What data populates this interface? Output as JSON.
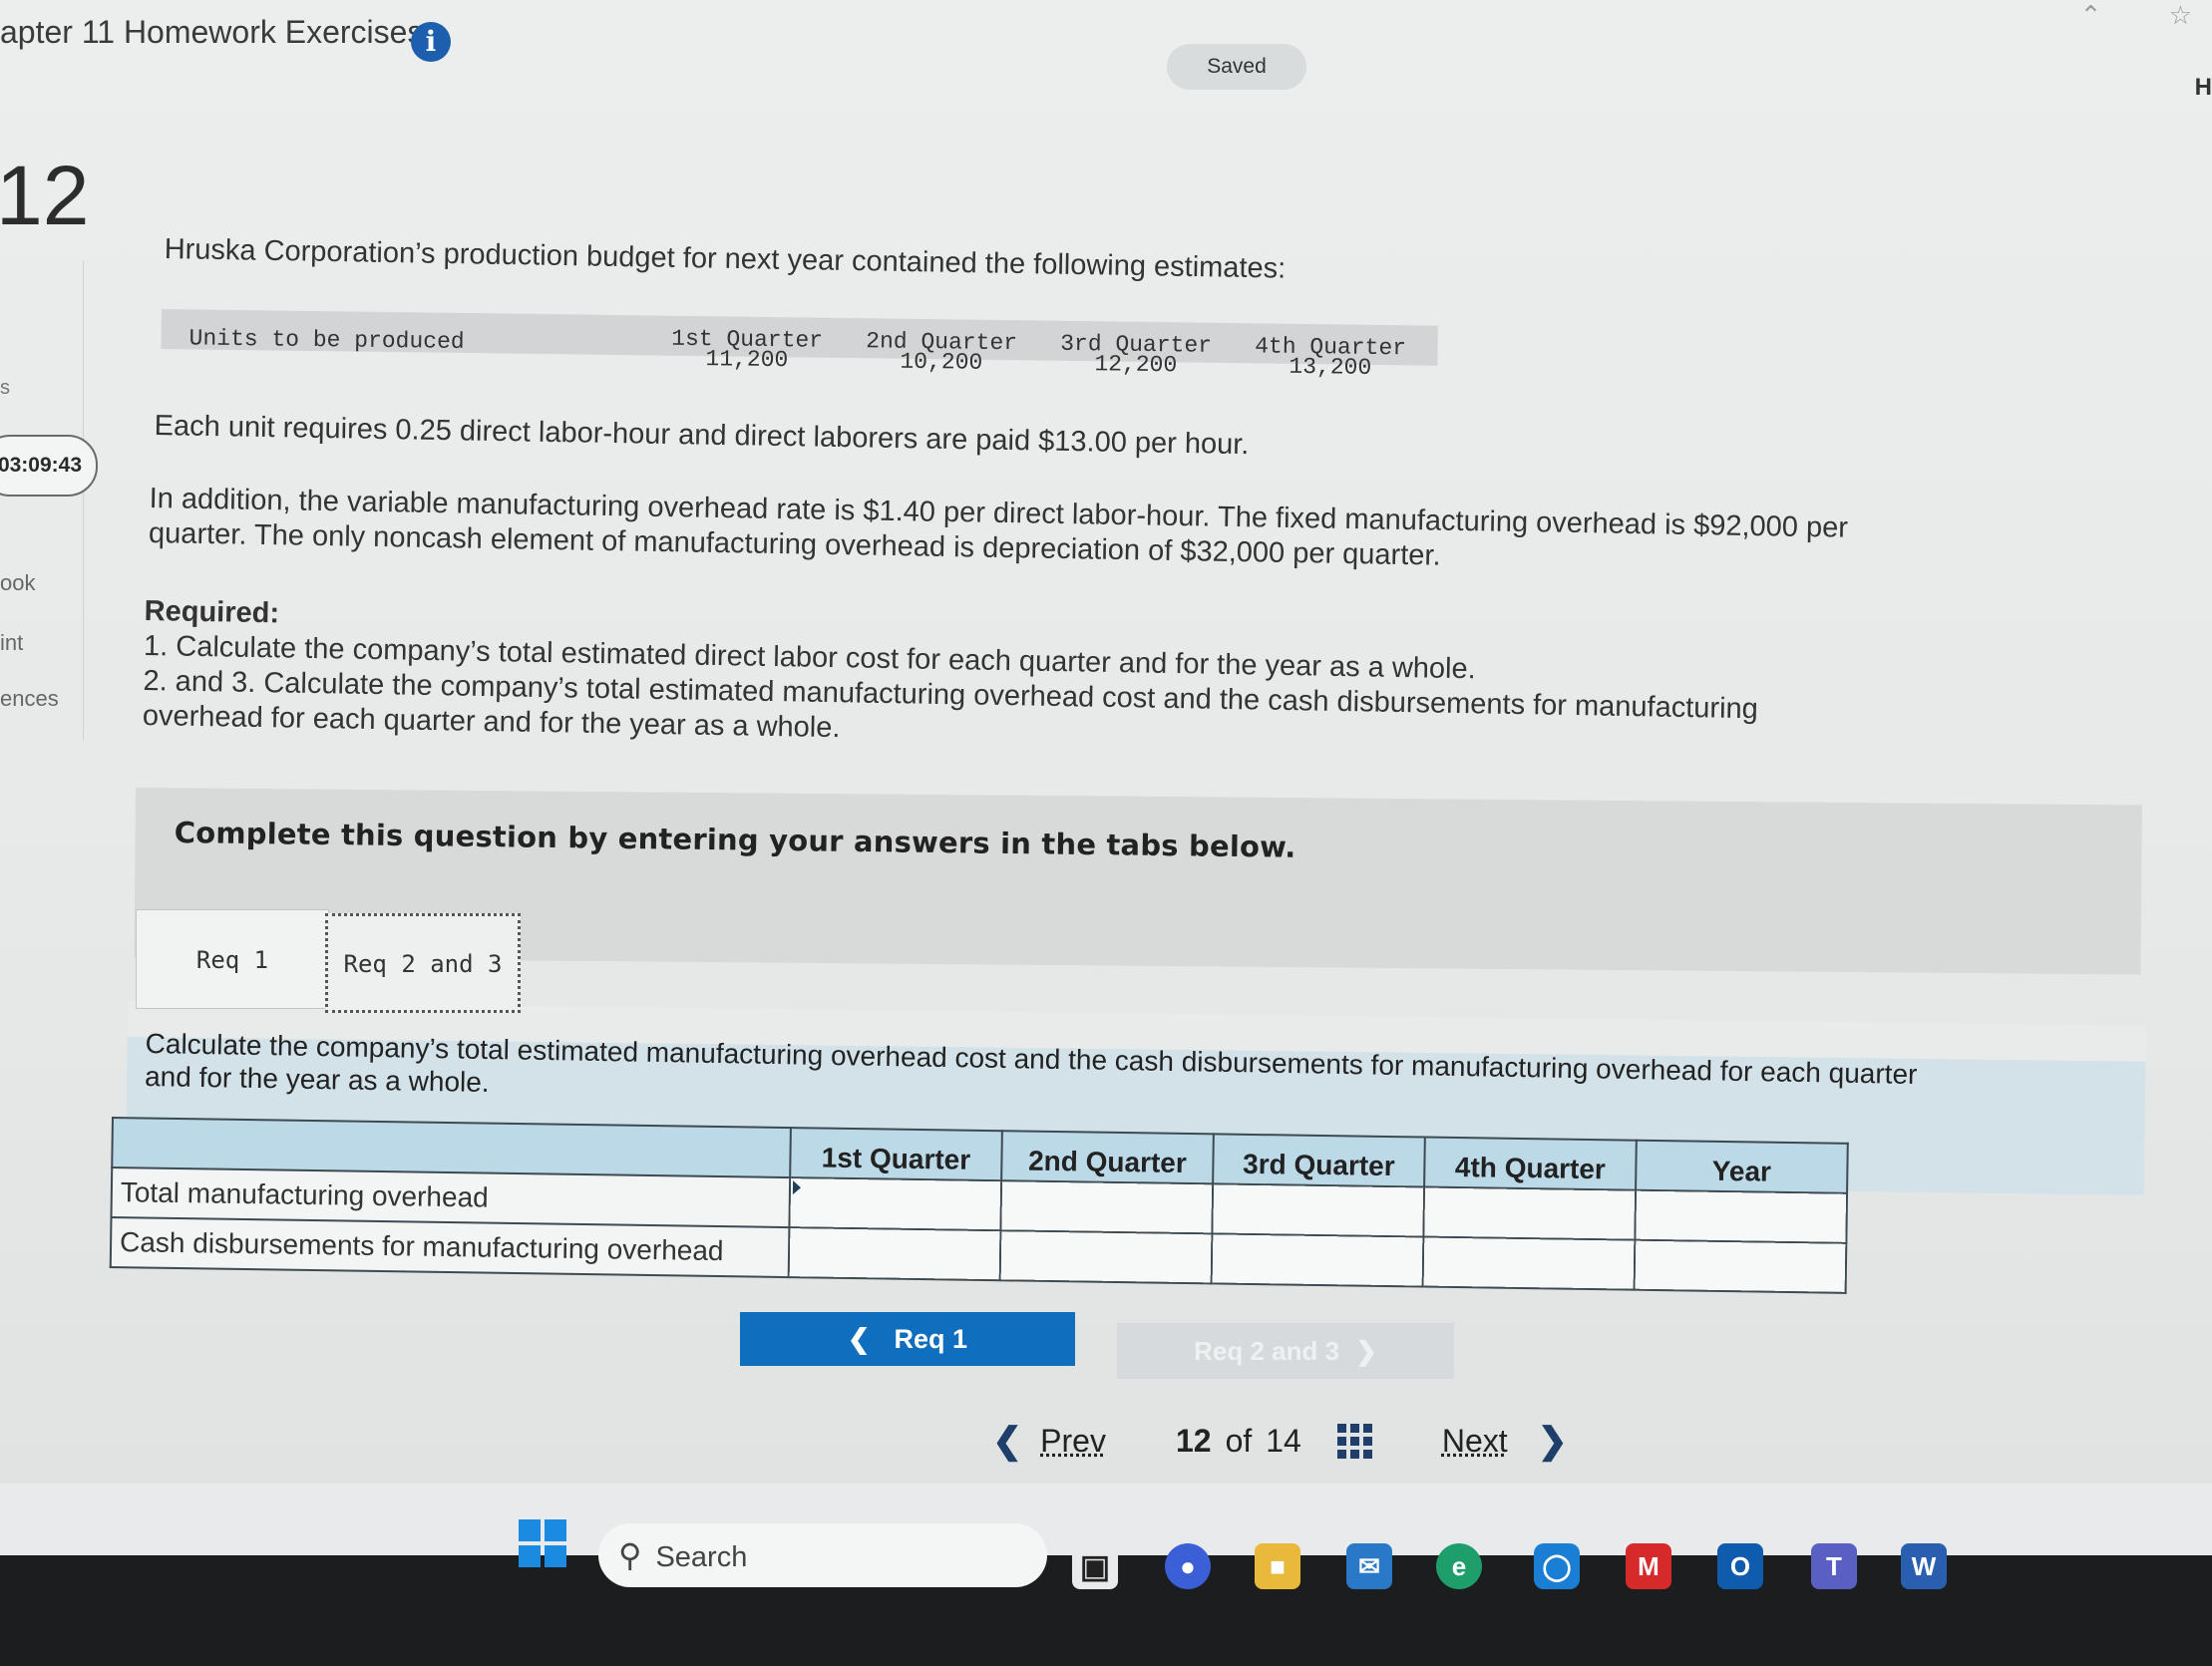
{
  "header": {
    "assignment_title": "apter 11 Homework Exercises",
    "info_icon": "i",
    "saved_label": "Saved",
    "corner_h": "H"
  },
  "rail": {
    "question_number": "12",
    "timer": "03:09:43",
    "ebook": "ook",
    "print": "int",
    "references": "ences",
    "dot": "s"
  },
  "problem": {
    "intro": "Hruska Corporation’s production budget for next year contained the following estimates:",
    "budget_table": {
      "row_label": "Units to be produced",
      "columns": [
        "1st Quarter",
        "2nd Quarter",
        "3rd Quarter",
        "4th Quarter"
      ],
      "values": [
        "11,200",
        "10,200",
        "12,200",
        "13,200"
      ]
    },
    "labor_text": "Each unit requires 0.25 direct labor-hour and direct laborers are paid $13.00 per hour.",
    "overhead_line1": "In addition, the variable manufacturing overhead rate is $1.40 per direct labor-hour. The fixed manufacturing overhead is $92,000 per",
    "overhead_line2": "quarter. The only noncash element of manufacturing overhead is depreciation of $32,000 per quarter.",
    "required_heading": "Required:",
    "required_1": "1. Calculate the company’s total estimated direct labor cost for each quarter and for the year as a whole.",
    "required_2_line1": "2. and 3. Calculate the company’s total estimated manufacturing overhead cost and the cash disbursements for manufacturing",
    "required_2_line2": "overhead for each quarter and for the year as a whole."
  },
  "instruction": "Complete this question by entering your answers in the tabs below.",
  "tabs": [
    {
      "label": "Req 1",
      "active": false
    },
    {
      "label": "Req 2 and 3",
      "active": true
    }
  ],
  "content": {
    "instruction_line1": "Calculate the company’s total estimated manufacturing overhead cost and the cash disbursements for manufacturing overhead for each quarter",
    "instruction_line2": "and for the year as a whole.",
    "table": {
      "columns": [
        "1st Quarter",
        "2nd Quarter",
        "3rd Quarter",
        "4th Quarter",
        "Year"
      ],
      "rows": [
        {
          "label": "Total manufacturing overhead",
          "values": [
            "",
            "",
            "",
            "",
            ""
          ]
        },
        {
          "label": "Cash disbursements for manufacturing overhead",
          "values": [
            "",
            "",
            "",
            "",
            ""
          ]
        }
      ]
    }
  },
  "nav": {
    "prev_req_label": "Req 1",
    "next_req_label": "Req 2 and 3",
    "prev_label": "Prev",
    "page_current": "12",
    "page_of": "of",
    "page_total": "14",
    "next_label": "Next"
  },
  "taskbar": {
    "search_label": "Search"
  },
  "colors": {
    "accent_blue": "#0f6fbe",
    "table_header": "#bcd9e8",
    "content_panel": "#d3e2e8"
  }
}
